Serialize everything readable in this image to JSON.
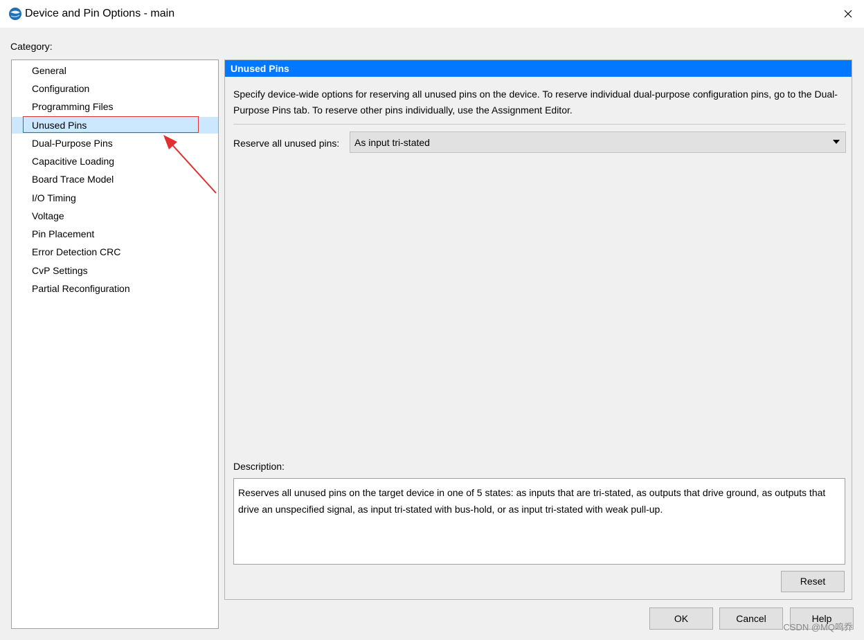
{
  "window": {
    "title": "Device and Pin Options - main",
    "icon": "quartus-globe-icon",
    "close_glyph": "✕"
  },
  "category": {
    "label": "Category:",
    "items": [
      {
        "label": "General"
      },
      {
        "label": "Configuration"
      },
      {
        "label": "Programming Files"
      },
      {
        "label": "Unused Pins"
      },
      {
        "label": "Dual-Purpose Pins"
      },
      {
        "label": "Capacitive Loading"
      },
      {
        "label": "Board Trace Model"
      },
      {
        "label": "I/O Timing"
      },
      {
        "label": "Voltage"
      },
      {
        "label": "Pin Placement"
      },
      {
        "label": "Error Detection CRC"
      },
      {
        "label": "CvP Settings"
      },
      {
        "label": "Partial Reconfiguration"
      }
    ],
    "selected": "Unused Pins"
  },
  "panel": {
    "title": "Unused Pins",
    "description": "Specify device-wide options for reserving all unused pins on the device. To reserve individual dual-purpose configuration pins, go to the Dual-Purpose Pins tab. To reserve other pins individually, use the Assignment Editor.",
    "reserve_label": "Reserve all unused pins:",
    "reserve_value": "As input tri-stated",
    "description_label": "Description:",
    "description_text": "Reserves all unused pins on the target device in one of 5 states: as inputs that are tri-stated, as outputs that drive ground, as outputs that drive an unspecified signal, as input tri-stated with bus-hold, or as input tri-stated with weak pull-up.",
    "reset_label": "Reset"
  },
  "buttons": {
    "ok": "OK",
    "cancel": "Cancel",
    "help": "Help"
  },
  "watermark": "CSDN @MQ鸣乔",
  "colors": {
    "header_blue": "#0078ff",
    "selection": "#cce8ff",
    "annotation_red": "#e03030"
  }
}
